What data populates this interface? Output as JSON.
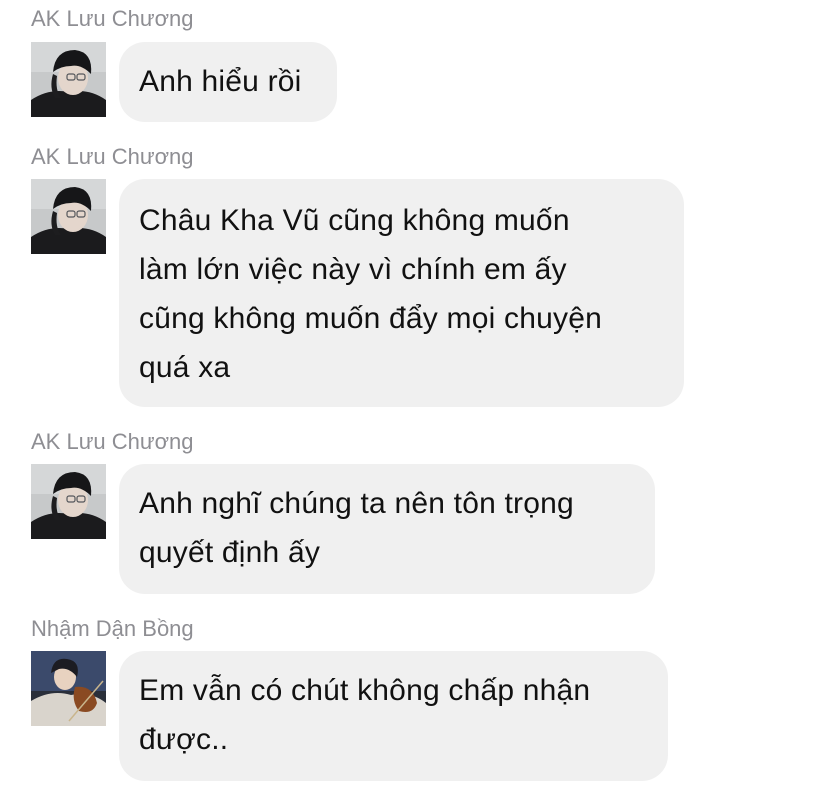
{
  "messages": [
    {
      "sender": "AK Lưu Chương",
      "avatar_icon": "user-avatar-black-beanie",
      "lines": [
        "Anh hiểu rồi"
      ]
    },
    {
      "sender": "AK Lưu Chương",
      "avatar_icon": "user-avatar-black-beanie",
      "lines": [
        "Châu Kha Vũ cũng không muốn",
        "làm lớn việc này vì chính em ấy",
        "cũng không muốn đẩy mọi chuyện",
        "quá xa"
      ]
    },
    {
      "sender": "AK Lưu Chương",
      "avatar_icon": "user-avatar-black-beanie",
      "lines": [
        "Anh nghĩ chúng ta nên tôn trọng",
        "quyết định ấy"
      ]
    },
    {
      "sender": "Nhậm Dận Bồng",
      "avatar_icon": "user-avatar-violin",
      "lines": [
        "Em vẫn có chút không chấp nhận",
        "được.."
      ]
    }
  ],
  "colors": {
    "bubble": "#f0f0f0",
    "sender_name": "#8e8e93",
    "message_text": "#111111"
  }
}
